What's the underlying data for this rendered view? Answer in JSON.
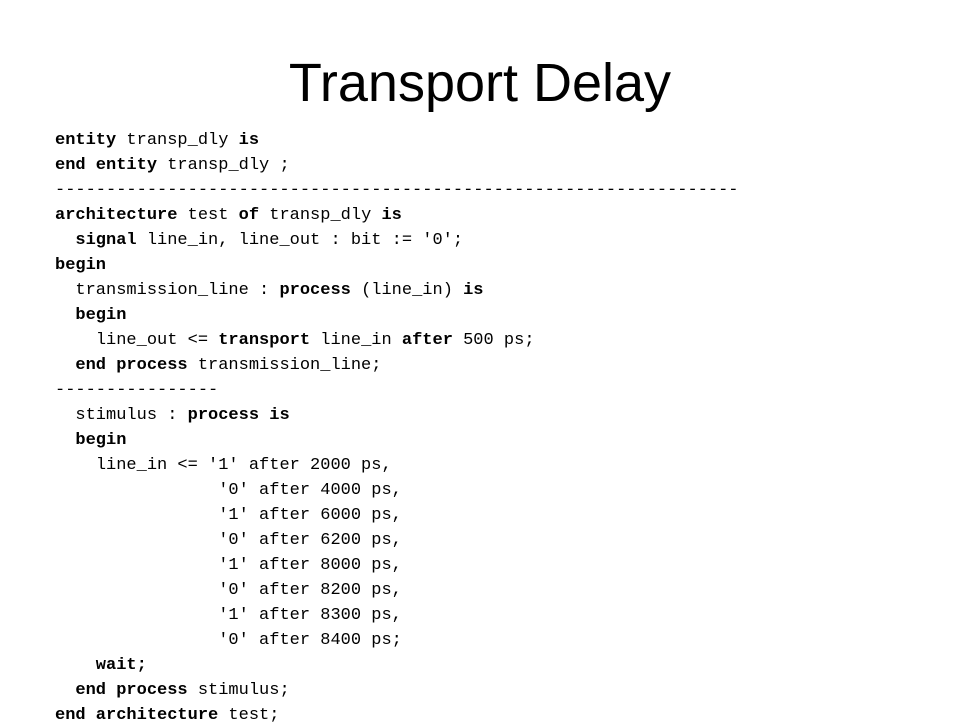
{
  "slide": {
    "title": "Transport Delay",
    "background_color": "#ffffff",
    "text_color": "#000000"
  },
  "code": {
    "language": "VHDL",
    "lines": [
      {
        "id": "line-entity-decl",
        "indent": 0,
        "spans": [
          {
            "text": "entity",
            "bold": true
          },
          {
            "text": " transp_dly ",
            "bold": false
          },
          {
            "text": "is",
            "bold": true
          }
        ]
      },
      {
        "id": "line-end-entity",
        "indent": 0,
        "spans": [
          {
            "text": "end entity",
            "bold": true
          },
          {
            "text": " transp_dly ;",
            "bold": false
          }
        ]
      },
      {
        "id": "line-separator-long",
        "indent": 0,
        "spans": [
          {
            "text": "-------------------------------------------------------------------",
            "bold": false
          }
        ]
      },
      {
        "id": "line-architecture-decl",
        "indent": 0,
        "spans": [
          {
            "text": "architecture",
            "bold": true
          },
          {
            "text": " test ",
            "bold": false
          },
          {
            "text": "of",
            "bold": true
          },
          {
            "text": " transp_dly ",
            "bold": false
          },
          {
            "text": "is",
            "bold": true
          }
        ]
      },
      {
        "id": "line-signal-decl",
        "indent": 1,
        "spans": [
          {
            "text": "signal",
            "bold": true
          },
          {
            "text": " line_in, line_out : bit := '0';",
            "bold": false
          }
        ]
      },
      {
        "id": "line-architecture-begin",
        "indent": 0,
        "spans": [
          {
            "text": "begin",
            "bold": true
          }
        ]
      },
      {
        "id": "line-transmission-process-decl",
        "indent": 1,
        "spans": [
          {
            "text": "transmission_line : ",
            "bold": false
          },
          {
            "text": "process",
            "bold": true
          },
          {
            "text": " (line_in) ",
            "bold": false
          },
          {
            "text": "is",
            "bold": true
          }
        ]
      },
      {
        "id": "line-transmission-begin",
        "indent": 1,
        "spans": [
          {
            "text": "begin",
            "bold": true
          }
        ]
      },
      {
        "id": "line-transport-assign",
        "indent": 2,
        "spans": [
          {
            "text": "line_out <= ",
            "bold": false
          },
          {
            "text": "transport",
            "bold": true
          },
          {
            "text": " line_in ",
            "bold": false
          },
          {
            "text": "after",
            "bold": true
          },
          {
            "text": " 500 ps;",
            "bold": false
          }
        ]
      },
      {
        "id": "line-end-transmission-process",
        "indent": 1,
        "spans": [
          {
            "text": "end process",
            "bold": true
          },
          {
            "text": " transmission_line;",
            "bold": false
          }
        ]
      },
      {
        "id": "line-separator-short",
        "indent": 0,
        "spans": [
          {
            "text": "----------------",
            "bold": false
          }
        ]
      },
      {
        "id": "line-stimulus-process-decl",
        "indent": 1,
        "spans": [
          {
            "text": "stimulus : ",
            "bold": false
          },
          {
            "text": "process is",
            "bold": true
          }
        ]
      },
      {
        "id": "line-stimulus-begin",
        "indent": 1,
        "spans": [
          {
            "text": "begin",
            "bold": true
          }
        ]
      },
      {
        "id": "line-stimulus-wave-1",
        "indent": 2,
        "spans": [
          {
            "text": "line_in <= '1' after 2000 ps,",
            "bold": false
          }
        ]
      },
      {
        "id": "line-stimulus-wave-2",
        "indent": 2,
        "spans": [
          {
            "text": "            '0' after 4000 ps,",
            "bold": false
          }
        ]
      },
      {
        "id": "line-stimulus-wave-3",
        "indent": 2,
        "spans": [
          {
            "text": "            '1' after 6000 ps,",
            "bold": false
          }
        ]
      },
      {
        "id": "line-stimulus-wave-4",
        "indent": 2,
        "spans": [
          {
            "text": "            '0' after 6200 ps,",
            "bold": false
          }
        ]
      },
      {
        "id": "line-stimulus-wave-5",
        "indent": 2,
        "spans": [
          {
            "text": "            '1' after 8000 ps,",
            "bold": false
          }
        ]
      },
      {
        "id": "line-stimulus-wave-6",
        "indent": 2,
        "spans": [
          {
            "text": "            '0' after 8200 ps,",
            "bold": false
          }
        ]
      },
      {
        "id": "line-stimulus-wave-7",
        "indent": 2,
        "spans": [
          {
            "text": "            '1' after 8300 ps,",
            "bold": false
          }
        ]
      },
      {
        "id": "line-stimulus-wave-8",
        "indent": 2,
        "spans": [
          {
            "text": "            '0' after 8400 ps;",
            "bold": false
          }
        ]
      },
      {
        "id": "line-wait",
        "indent": 1,
        "spans": [
          {
            "text": "  wait;",
            "bold": true
          }
        ]
      },
      {
        "id": "line-end-stimulus-process",
        "indent": 1,
        "spans": [
          {
            "text": "end process",
            "bold": true
          },
          {
            "text": " stimulus;",
            "bold": false
          }
        ]
      },
      {
        "id": "line-end-architecture",
        "indent": 0,
        "spans": [
          {
            "text": "end architecture",
            "bold": true
          },
          {
            "text": " test;",
            "bold": false
          }
        ]
      }
    ]
  }
}
